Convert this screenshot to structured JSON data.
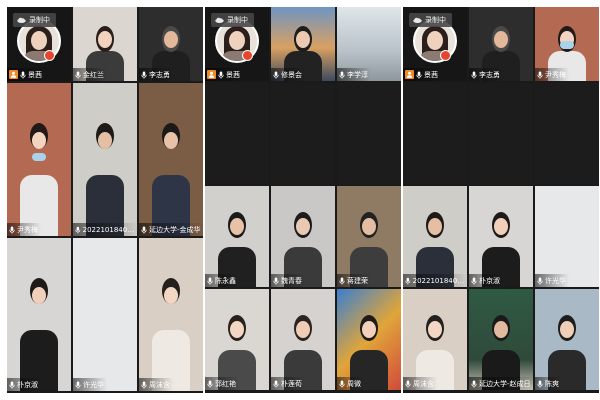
{
  "recording_badge": "录制中",
  "panels": [
    {
      "tiles": [
        {
          "name": "景茜",
          "host": true,
          "avatar": true,
          "bg": "#161616"
        },
        {
          "name": "金红兰",
          "bg": "#dcd6d0",
          "person": {
            "skin": "#f1d3bf",
            "hair": "#2a1e1a",
            "body": "#3b3b3b"
          }
        },
        {
          "name": "李志勇",
          "bg": "#2d2d2d",
          "person": {
            "skin": "#e2b79a",
            "hair": "#4a4a4a",
            "body": "#1f1f1f"
          }
        },
        {
          "name": "尹秀梅",
          "bg": "#b46a52",
          "person": {
            "skin": "#f2d4c0",
            "hair": "#231a17",
            "body": "#e8e8e8"
          },
          "mask": true
        },
        {
          "name": "20221018404...",
          "bg": "#cfcdc8",
          "person": {
            "skin": "#e4bfa4",
            "hair": "#1d1a18",
            "body": "#2a2f3a"
          }
        },
        {
          "name": "延边大学-金成华",
          "bg": "#7b5c44",
          "person": {
            "skin": "#e7c2a6",
            "hair": "#1a1a1a",
            "body": "#2e3546"
          }
        },
        {
          "name": "朴京淑",
          "bg": "#d7d6d4",
          "person": {
            "skin": "#f0d0bb",
            "hair": "#1e1a18",
            "body": "#1c1c1c"
          }
        },
        {
          "name": "许光华",
          "bg": "#e7e8ea",
          "person": null
        },
        {
          "name": "周沫含",
          "bg": "#d9cfc5",
          "person": {
            "skin": "#f3d6c3",
            "hair": "#23201d",
            "body": "#efe9e3"
          }
        }
      ]
    },
    {
      "tiles": [
        {
          "name": "景茜",
          "host": true,
          "avatar": true,
          "bg": "#161616"
        },
        {
          "name": "修景会",
          "bg": "#5a7fa8",
          "person": {
            "skin": "#ecc9b0",
            "hair": "#1d1d1d",
            "body": "#222222"
          },
          "sunset": true
        },
        {
          "name": "李学淳",
          "bg": "#cbd5db",
          "person": null,
          "office": true
        },
        {
          "name": "",
          "bg": "#1c1c1c",
          "person": null,
          "empty": true
        },
        {
          "name": "",
          "bg": "#1c1c1c",
          "person": null,
          "empty": true
        },
        {
          "name": "",
          "bg": "#1c1c1c",
          "person": null,
          "empty": true
        },
        {
          "name": "陈永鑫",
          "bg": "#d2d0cd",
          "person": {
            "skin": "#e8c2a6",
            "hair": "#1a1a1a",
            "body": "#202020"
          }
        },
        {
          "name": "魏青春",
          "bg": "#c9c8c6",
          "person": {
            "skin": "#e9c9b4",
            "hair": "#1c1c1c",
            "body": "#3a3a3a"
          }
        },
        {
          "name": "蒋建荣",
          "bg": "#8f7a63",
          "person": {
            "skin": "#e4bda2",
            "hair": "#222",
            "body": "#3d3d3d"
          },
          "active": true
        },
        {
          "name": "郭红艳",
          "bg": "#dad6d2",
          "person": {
            "skin": "#f3d6c3",
            "hair": "#2a211d",
            "body": "#4a4a4a"
          }
        },
        {
          "name": "朴莲荀",
          "bg": "#d5d2cf",
          "person": {
            "skin": "#efcdb6",
            "hair": "#2b241f",
            "body": "#3a3a3a"
          }
        },
        {
          "name": "周微",
          "bg": "#e0a53a",
          "person": {
            "skin": "#f1d1bc",
            "hair": "#1f1b18",
            "body": "#262626"
          },
          "colorful": true
        }
      ]
    },
    {
      "tiles": [
        {
          "name": "景茜",
          "host": true,
          "avatar": true,
          "bg": "#161616"
        },
        {
          "name": "李志勇",
          "bg": "#2d2d2d",
          "person": {
            "skin": "#e2b79a",
            "hair": "#4a4a4a",
            "body": "#1f1f1f"
          }
        },
        {
          "name": "尹秀梅",
          "bg": "#b46a52",
          "person": {
            "skin": "#f2d4c0",
            "hair": "#231a17",
            "body": "#e8e8e8"
          },
          "mask": true
        },
        {
          "name": "",
          "bg": "#1c1c1c",
          "person": null,
          "empty": true
        },
        {
          "name": "",
          "bg": "#1c1c1c",
          "person": null,
          "empty": true
        },
        {
          "name": "",
          "bg": "#1c1c1c",
          "person": null,
          "empty": true
        },
        {
          "name": "20221018404...",
          "bg": "#cfcdc8",
          "person": {
            "skin": "#e4bfa4",
            "hair": "#1d1a18",
            "body": "#2a2f3a"
          }
        },
        {
          "name": "朴京淑",
          "bg": "#d7d6d4",
          "person": {
            "skin": "#f0d0bb",
            "hair": "#1e1a18",
            "body": "#1c1c1c"
          }
        },
        {
          "name": "许光华",
          "bg": "#e7e8ea",
          "person": null
        },
        {
          "name": "周沫含",
          "bg": "#d9cfc5",
          "person": {
            "skin": "#f3d6c3",
            "hair": "#23201d",
            "body": "#efe9e3"
          }
        },
        {
          "name": "延边大学-赵成日",
          "bg": "#2f4a3a",
          "person": {
            "skin": "#e0b99e",
            "hair": "#1a1a1a",
            "body": "#1a1a1a"
          },
          "board": true
        },
        {
          "name": "陈爽",
          "bg": "#a9b9c6",
          "person": {
            "skin": "#efcfb8",
            "hair": "#1e1e1e",
            "body": "#2a2a2a"
          }
        }
      ]
    }
  ]
}
